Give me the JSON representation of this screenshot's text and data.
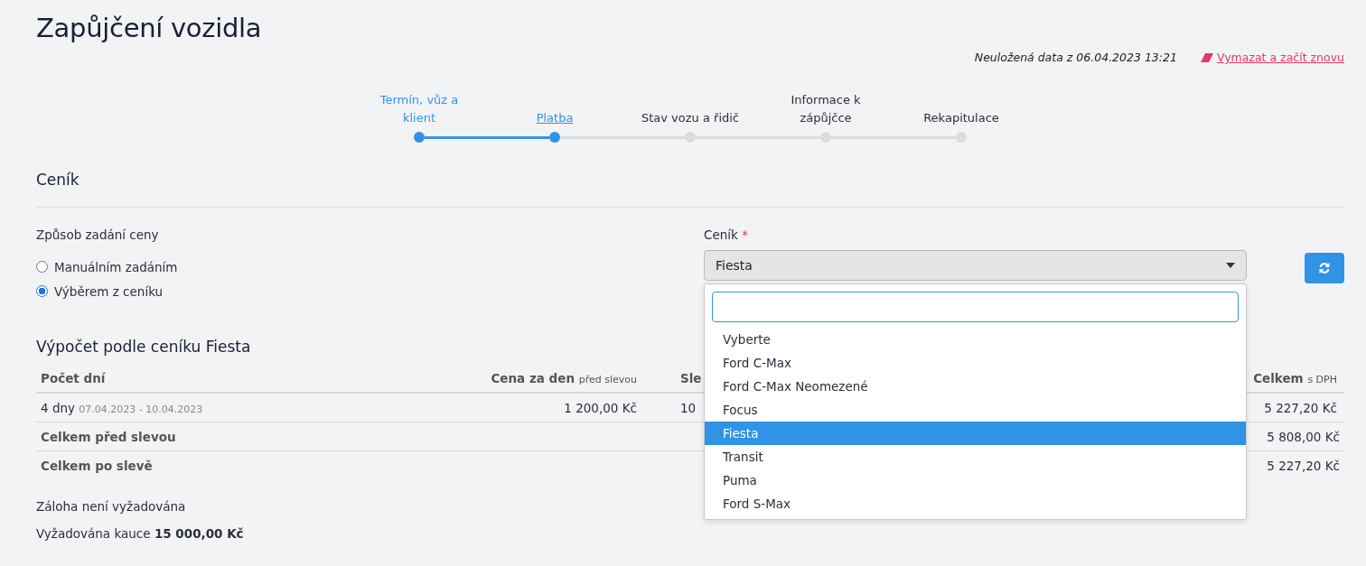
{
  "page": {
    "title": "Zapůjčení vozidla"
  },
  "draft_notice": {
    "text": "Neuložená data z 06.04.2023 13:21",
    "reset_link": "Vymazat a začít znovu"
  },
  "steps": [
    {
      "label": "Termín, vůz a klient",
      "completed": true,
      "selected": false
    },
    {
      "label": "Platba",
      "completed": true,
      "selected": true
    },
    {
      "label": "Stav vozu a řidič",
      "completed": false,
      "selected": false
    },
    {
      "label": "Informace k zápůjčce",
      "completed": false,
      "selected": false
    },
    {
      "label": "Rekapitulace",
      "completed": false,
      "selected": false
    }
  ],
  "pricing": {
    "heading": "Ceník",
    "price_method": {
      "label": "Způsob zadání ceny",
      "options": [
        {
          "label": "Manuálním zadáním",
          "selected": false
        },
        {
          "label": "Výběrem z ceníku",
          "selected": true
        }
      ]
    },
    "price_list": {
      "label": "Ceník",
      "required_mark": "*",
      "value": "Fiesta",
      "expanded": true,
      "options": [
        {
          "label": "Vyberte",
          "selected": false
        },
        {
          "label": "Ford C-Max",
          "selected": false
        },
        {
          "label": "Ford C-Max Neomezené",
          "selected": false
        },
        {
          "label": "Focus",
          "selected": false
        },
        {
          "label": "Fiesta",
          "selected": true
        },
        {
          "label": "Transit",
          "selected": false
        },
        {
          "label": "Puma",
          "selected": false
        },
        {
          "label": "Ford S-Max",
          "selected": false
        }
      ]
    }
  },
  "calculation": {
    "heading": "Výpočet podle ceníku Fiesta",
    "columns": [
      {
        "label": "Počet dní"
      },
      {
        "label": "Cena za den",
        "note": "před slevou"
      },
      {
        "label": "Sle"
      },
      {
        "label": "Celkem",
        "note": "s DPH"
      }
    ],
    "rows": [
      {
        "kind": "item",
        "cells": [
          {
            "text": "4 dny",
            "note": "07.04.2023 - 10.04.2023"
          },
          {
            "text": "1 200,00 Kč"
          },
          {
            "text": "10"
          },
          {
            "text": "5 227,20 Kč"
          }
        ]
      },
      {
        "kind": "summary",
        "label": "Celkem před slevou",
        "total": "5 808,00 Kč"
      },
      {
        "kind": "summary",
        "label": "Celkem po slevě",
        "total": "5 227,20 Kč"
      }
    ],
    "deposit_note": "Záloha není vyžadována",
    "bond": "Vyžadována kauce **15 000,00 Kč**"
  }
}
